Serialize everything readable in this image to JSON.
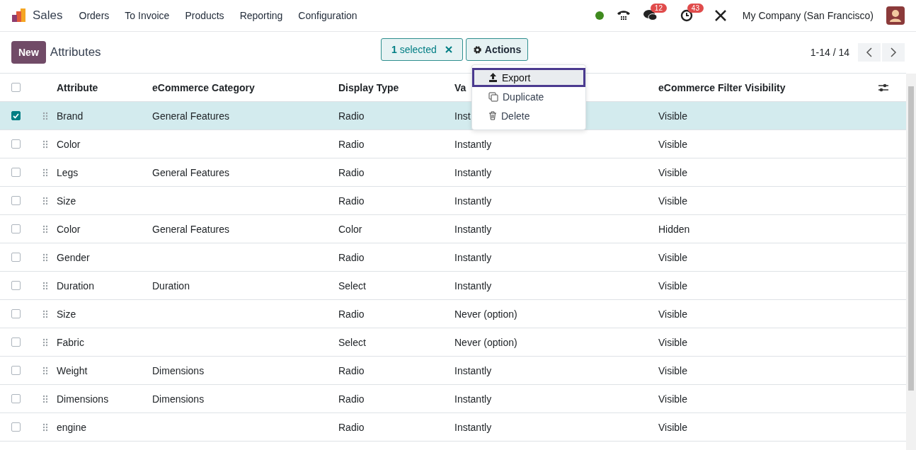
{
  "navbar": {
    "app": "Sales",
    "menu": [
      "Orders",
      "To Invoice",
      "Products",
      "Reporting",
      "Configuration"
    ],
    "messages_badge": "12",
    "activities_badge": "43",
    "company": "My Company (San Francisco)"
  },
  "control_panel": {
    "new_button": "New",
    "title": "Attributes",
    "selection": {
      "count": "1",
      "label": "selected"
    },
    "actions_button": "Actions",
    "pager": "1-14 / 14"
  },
  "actions_menu": [
    {
      "kind": "export",
      "label": "Export",
      "selected": true
    },
    {
      "kind": "duplicate",
      "label": "Duplicate",
      "selected": false
    },
    {
      "kind": "delete",
      "label": "Delete",
      "selected": false
    }
  ],
  "table": {
    "all_checked": false,
    "columns": [
      "Attribute",
      "eCommerce Category",
      "Display Type",
      "Va",
      "eCommerce Filter Visibility"
    ],
    "rows": [
      {
        "cells": [
          "Brand",
          "General Features",
          "Radio",
          "Inst",
          "Visible"
        ],
        "selected": true
      },
      {
        "cells": [
          "Color",
          "",
          "Radio",
          "Instantly",
          "Visible"
        ],
        "selected": false
      },
      {
        "cells": [
          "Legs",
          "General Features",
          "Radio",
          "Instantly",
          "Visible"
        ],
        "selected": false
      },
      {
        "cells": [
          "Size",
          "",
          "Radio",
          "Instantly",
          "Visible"
        ],
        "selected": false
      },
      {
        "cells": [
          "Color",
          "General Features",
          "Color",
          "Instantly",
          "Hidden"
        ],
        "selected": false
      },
      {
        "cells": [
          "Gender",
          "",
          "Radio",
          "Instantly",
          "Visible"
        ],
        "selected": false
      },
      {
        "cells": [
          "Duration",
          "Duration",
          "Select",
          "Instantly",
          "Visible"
        ],
        "selected": false
      },
      {
        "cells": [
          "Size",
          "",
          "Radio",
          "Never (option)",
          "Visible"
        ],
        "selected": false
      },
      {
        "cells": [
          "Fabric",
          "",
          "Select",
          "Never (option)",
          "Visible"
        ],
        "selected": false
      },
      {
        "cells": [
          "Weight",
          "Dimensions",
          "Radio",
          "Instantly",
          "Visible"
        ],
        "selected": false
      },
      {
        "cells": [
          "Dimensions",
          "Dimensions",
          "Radio",
          "Instantly",
          "Visible"
        ],
        "selected": false
      },
      {
        "cells": [
          "engine",
          "",
          "Radio",
          "Instantly",
          "Visible"
        ],
        "selected": false
      }
    ]
  }
}
